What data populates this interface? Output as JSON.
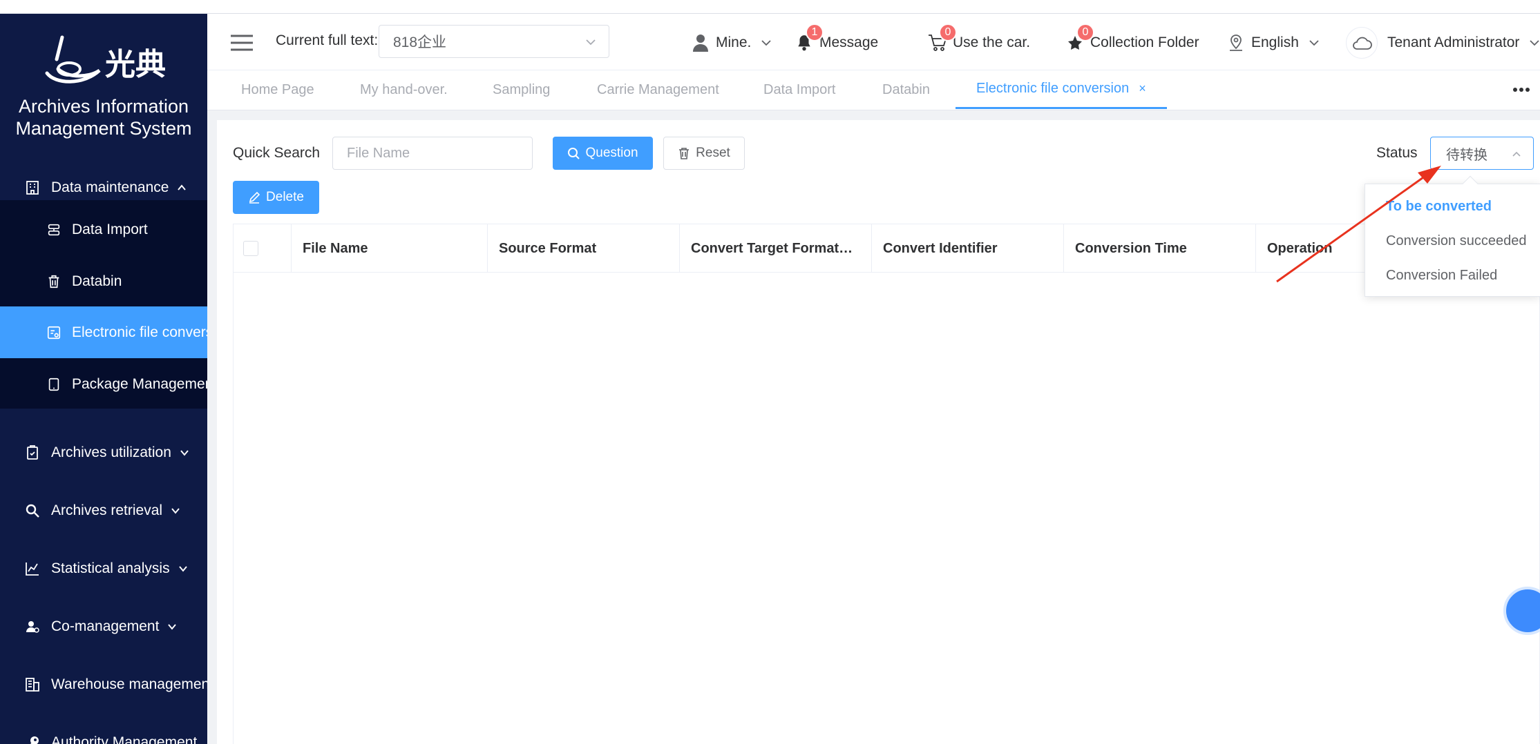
{
  "sidebar": {
    "logo_text": "光典",
    "system_title_line1": "Archives Information",
    "system_title_line2": "Management System",
    "menu": [
      {
        "label": "Data maintenance"
      },
      {
        "label": "Archives utilization"
      },
      {
        "label": "Archives retrieval"
      },
      {
        "label": "Statistical analysis"
      },
      {
        "label": "Co-management"
      },
      {
        "label": "Warehouse management"
      },
      {
        "label": "Authority Management"
      }
    ],
    "submenu": [
      {
        "label": "Data Import"
      },
      {
        "label": "Databin"
      },
      {
        "label": "Electronic file conversion"
      },
      {
        "label": "Package Management"
      }
    ]
  },
  "header": {
    "full_text_label": "Current full text:",
    "full_text_value": "818企业",
    "mine_label": "Mine.",
    "message_label": "Message",
    "message_count": "1",
    "car_label": "Use the car.",
    "car_count": "0",
    "collection_label": "Collection Folder",
    "collection_count": "0",
    "language_label": "English",
    "user_label": "Tenant Administrator"
  },
  "tabs": [
    {
      "label": "Home Page"
    },
    {
      "label": "My hand-over."
    },
    {
      "label": "Sampling"
    },
    {
      "label": "Carrie Management"
    },
    {
      "label": "Data Import"
    },
    {
      "label": "Databin"
    },
    {
      "label": "Electronic file conversion"
    }
  ],
  "toolbar": {
    "quick_search_label": "Quick Search",
    "search_placeholder": "File Name",
    "question_label": "Question",
    "reset_label": "Reset",
    "delete_label": "Delete",
    "status_label": "Status",
    "status_value": "待转换"
  },
  "table": {
    "columns": [
      "File Name",
      "Source Format",
      "Convert Target Format…",
      "Convert Identifier",
      "Conversion Time",
      "Operation"
    ]
  },
  "status_dropdown": {
    "options": [
      "To be converted",
      "Conversion succeeded",
      "Conversion Failed"
    ],
    "selected_index": 0
  },
  "colors": {
    "primary": "#409eff",
    "sidebar_bg": "#0e1a45",
    "badge": "#f56c6c",
    "annotation": "#e8321e"
  }
}
